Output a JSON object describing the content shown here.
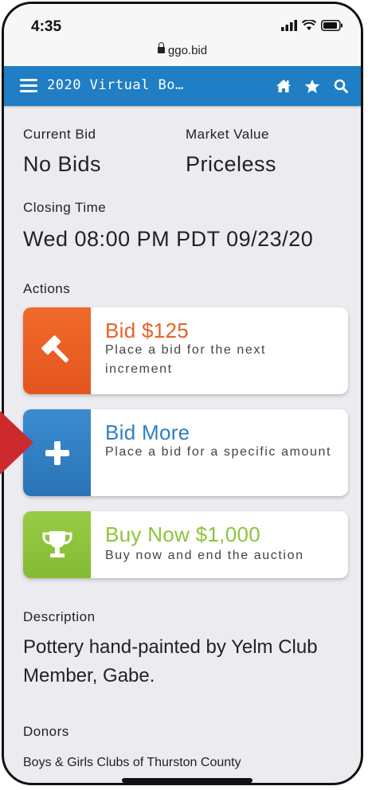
{
  "status": {
    "time": "4:35",
    "url": "ggo.bid"
  },
  "nav": {
    "title": "2020 Virtual Bo…"
  },
  "bid": {
    "current_bid_label": "Current Bid",
    "current_bid_value": "No Bids",
    "market_value_label": "Market Value",
    "market_value_value": "Priceless",
    "closing_label": "Closing Time",
    "closing_value": "Wed 08:00 PM PDT 09/23/20",
    "actions_label": "Actions"
  },
  "actions": [
    {
      "title": "Bid $125",
      "subtitle": "Place a bid for the next increment",
      "color": "#ea6025",
      "icon": "gavel-icon"
    },
    {
      "title": "Bid More",
      "subtitle": "Place a bid for a specific amount",
      "color": "#2f7fc2",
      "icon": "plus-icon"
    },
    {
      "title": "Buy Now $1,000",
      "subtitle": "Buy now and end the auction",
      "color": "#8cc43c",
      "icon": "trophy-icon"
    }
  ],
  "description": {
    "label": "Description",
    "text": "Pottery hand-painted by Yelm Club Member, Gabe."
  },
  "donors": {
    "label": "Donors",
    "text": "Boys & Girls Clubs of Thurston County"
  }
}
